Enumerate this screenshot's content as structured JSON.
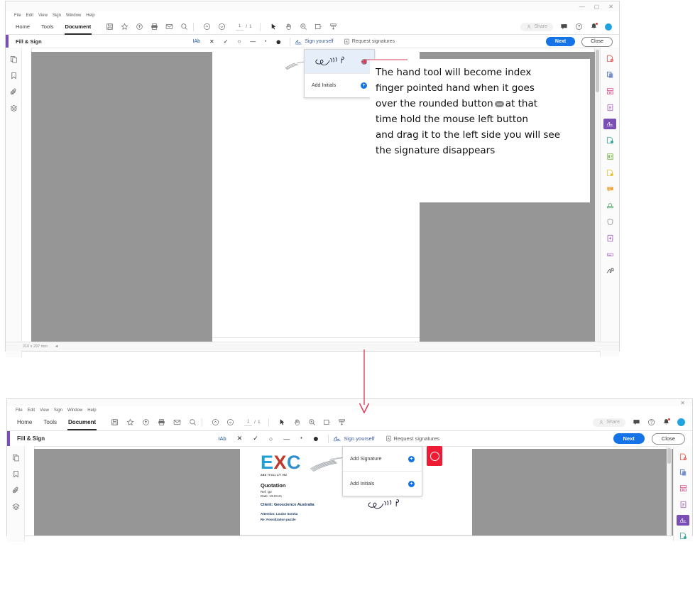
{
  "windows": {
    "top": {
      "menubar": [
        "File",
        "Edit",
        "View",
        "Sign",
        "Window",
        "Help"
      ],
      "window_controls": [
        "minimize",
        "maximize",
        "close"
      ],
      "nav_tabs": [
        "Home",
        "Tools",
        "Document"
      ],
      "active_tab": "Document",
      "nav_icons": [
        "save-icon",
        "star-icon",
        "upload-cloud-icon",
        "print-icon",
        "email-icon",
        "search-icon"
      ],
      "page_nav": {
        "up": "previous-page-icon",
        "down": "next-page-icon",
        "current": "1",
        "separator": "/",
        "total": "1"
      },
      "view_icons": [
        "select-cursor-icon",
        "hand-tool-icon",
        "zoom-in-icon",
        "page-fit-icon",
        "stamp-icon"
      ],
      "share_label": "Share",
      "topright_icons": [
        "comment-icon",
        "help-icon",
        "notification-bell-icon",
        "user-avatar"
      ],
      "fill_sign": {
        "title": "Fill & Sign",
        "tools": [
          "text-tool",
          "cross-mark-tool",
          "check-mark-tool",
          "circle-tool",
          "line-tool",
          "dot-tool",
          "color-swatch"
        ],
        "tool_glyphs": [
          "IAb",
          "✕",
          "✓",
          "○",
          "—",
          "•",
          "●"
        ],
        "sign_yourself": "Sign yourself",
        "request_signatures": "Request signatures",
        "next": "Next",
        "close": "Close"
      },
      "signature_panel": {
        "saved_signature_label": "saved-signature",
        "remove_label": "−",
        "add_initials": "Add Initials",
        "plus_label": "+"
      },
      "left_rail": [
        "page-thumbnails-icon",
        "bookmark-icon",
        "attachment-icon",
        "layers-icon"
      ],
      "right_rail": [
        "create-pdf-icon",
        "combine-files-icon",
        "organize-pages-icon",
        "export-pdf-icon",
        "fill-sign-icon",
        "edit-pdf-icon",
        "compress-pdf-icon",
        "protect-icon",
        "comment-icon",
        "stamp-icon",
        "shield-icon",
        "add-page-icon",
        "redact-icon",
        "certificates-icon"
      ],
      "right_rail_selected_index": 4,
      "status_text": "210 x 297 mm",
      "annotation": {
        "line1": "The hand tool will become index",
        "line2": "finger pointed hand when it goes",
        "line3_a": "over the rounded button",
        "line3_b": "at that",
        "line4": "time hold the mouse left button",
        "line5": "and drag it to the left side you will see",
        "line6": "the signature disappears",
        "inline_button_name": "rounded-remove-button"
      }
    },
    "bottom": {
      "menubar": [
        "File",
        "Edit",
        "View",
        "Sign",
        "Window",
        "Help"
      ],
      "window_controls": [
        "close"
      ],
      "nav_tabs": [
        "Home",
        "Tools",
        "Document"
      ],
      "active_tab": "Document",
      "nav_icons": [
        "save-icon",
        "star-icon",
        "upload-cloud-icon",
        "print-icon",
        "email-icon",
        "search-icon"
      ],
      "page_nav": {
        "up": "previous-page-icon",
        "down": "next-page-icon",
        "current": "1",
        "separator": "/",
        "total": "1"
      },
      "view_icons": [
        "select-cursor-icon",
        "hand-tool-icon",
        "zoom-in-icon",
        "page-fit-icon",
        "stamp-icon"
      ],
      "share_label": "Share",
      "topright_icons": [
        "comment-icon",
        "help-icon",
        "notification-bell-icon",
        "user-avatar"
      ],
      "fill_sign": {
        "title": "Fill & Sign",
        "tool_glyphs": [
          "IAb",
          "✕",
          "✓",
          "○",
          "—",
          "•",
          "●"
        ],
        "sign_yourself": "Sign yourself",
        "request_signatures": "Request signatures",
        "next": "Next",
        "close": "Close"
      },
      "signature_panel": {
        "add_signature": "Add Signature",
        "add_initials": "Add Initials",
        "plus_label": "+"
      },
      "left_rail": [
        "page-thumbnails-icon",
        "bookmark-icon",
        "attachment-icon",
        "layers-icon"
      ],
      "right_rail": [
        "create-pdf-icon",
        "combine-files-icon",
        "organize-pages-icon",
        "export-pdf-icon",
        "fill-sign-icon",
        "edit-pdf-icon"
      ],
      "right_rail_selected_index": 4,
      "document": {
        "logo_e": "E",
        "logo_x": "X",
        "logo_c": "C",
        "abn": "ABN 79 611 177 952",
        "title": "Quotation",
        "ref": "Ref: Q2",
        "date": "Date: 13.03.21",
        "client": "Client: Geoscience Australia",
        "attention": "Attention: Louise Soroka",
        "subject": "Re: Fossilization puzzle",
        "stamp_name": "red-approval-stamp",
        "signature_name": "drawn-signature"
      }
    }
  },
  "connector": {
    "name": "red-flow-arrow",
    "color": "#d8415c"
  },
  "colors": {
    "accent_purple": "#7a4fb5",
    "primary_blue": "#1473e6",
    "gray_block": "#969696",
    "arrow_red": "#d8415c"
  }
}
